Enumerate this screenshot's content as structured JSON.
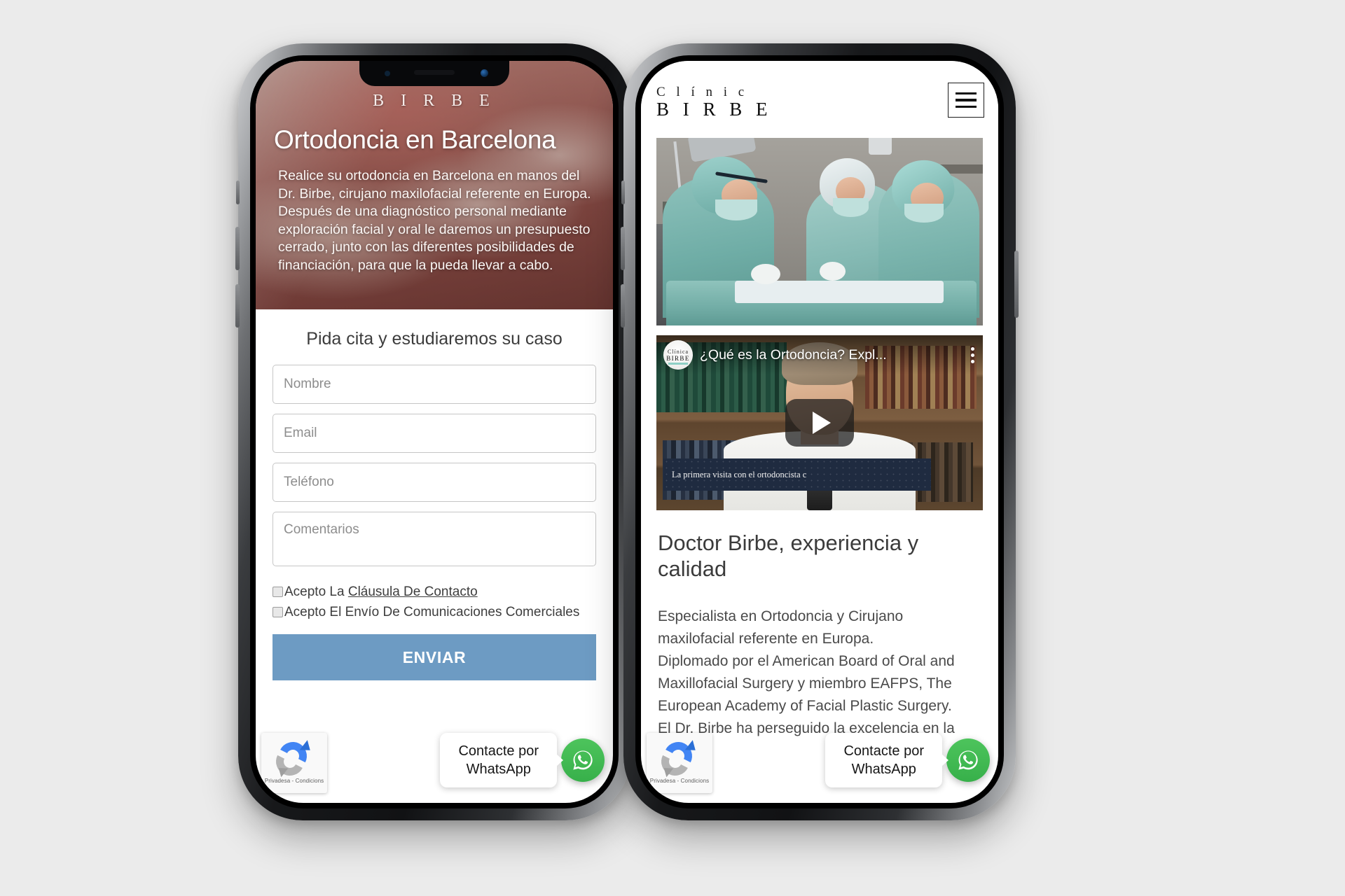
{
  "page": {
    "background_color": "#ebebeb"
  },
  "phone1": {
    "hero": {
      "logo": "B I R B E",
      "title": "Ortodoncia en Barcelona",
      "paragraph": "Realice su ortodoncia en Barcelona en manos del Dr. Birbe, cirujano maxilofacial referente en Europa.\nDespués de una diagnóstico personal mediante exploración facial y oral le daremos un presupuesto cerrado, junto con las diferentes posibilidades de financiación, para que la pueda llevar a cabo."
    },
    "form": {
      "title": "Pida cita y estudiaremos su caso",
      "fields": [
        {
          "name": "nombre",
          "placeholder": "Nombre",
          "value": ""
        },
        {
          "name": "email",
          "placeholder": "Email",
          "value": ""
        },
        {
          "name": "telefono",
          "placeholder": "Teléfono",
          "value": ""
        },
        {
          "name": "comentarios",
          "placeholder": "Comentarios",
          "value": ""
        }
      ],
      "consent": [
        {
          "prefix": "Acepto La ",
          "link": "Cláusula De Contacto",
          "checked": false
        },
        {
          "prefix": "Acepto El Envío De Comunicaciones Comerciales",
          "link": "",
          "checked": false
        }
      ],
      "submit_label": "ENVIAR"
    },
    "recaptcha": {
      "text": "Privadesa - Condicions"
    },
    "whatsapp": {
      "bubble_line1": "Contacte por",
      "bubble_line2": "WhatsApp"
    }
  },
  "phone2": {
    "header": {
      "brand_line1": "C l í n i c",
      "brand_line2": "B I R B E",
      "menu_icon": "hamburger-icon"
    },
    "surgery_image_alt": "surgical team operating",
    "video": {
      "title": "¿Qué es la Ortodoncia? Expl...",
      "channel_line1": "Clínica",
      "channel_line2": "BIRBE",
      "caption": "La primera visita con el ortodoncista c",
      "play_icon": "play-icon",
      "menu_icon": "kebab-menu-icon"
    },
    "heading": "Doctor Birbe, experiencia y calidad",
    "paragraph_lines": [
      "Especialista en Ortodoncia y Cirujano",
      "maxilofacial referente en Europa.",
      "Diplomado por el American Board of Oral and",
      "Maxillofacial Surgery y miembro EAFPS, The",
      "European Academy of Facial Plastic Surgery.",
      "El Dr. Birbe ha perseguido la excelencia en la"
    ],
    "recaptcha": {
      "text": "Privadesa - Condicions"
    },
    "whatsapp": {
      "bubble_line1": "Contacte por",
      "bubble_line2": "WhatsApp"
    }
  },
  "colors": {
    "accent_button": "#6d9bc3",
    "whatsapp_green": "#37b04a",
    "page_bg": "#ebebeb"
  }
}
